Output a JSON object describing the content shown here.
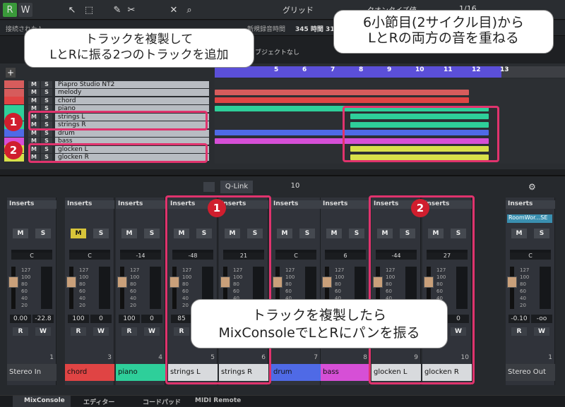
{
  "toolbar": {
    "grid_label": "グリッド",
    "quantize_label": "クオンタイズ値",
    "quantize_value": "1/16"
  },
  "infobar": {
    "left": "接続されたト",
    "mid": "新規録音時間",
    "free": "345 時間 31 分"
  },
  "arranger": {
    "bars": [
      "5",
      "6",
      "7",
      "8",
      "9",
      "10",
      "11",
      "12",
      "13"
    ],
    "no_object": "オブジェクトなし",
    "tracks": [
      {
        "name": "Piapro Studio NT2",
        "color": "#d65c5c"
      },
      {
        "name": "melody",
        "color": "#d65c5c"
      },
      {
        "name": "chord",
        "color": "#e04444"
      },
      {
        "name": "piano",
        "color": "#2ecf9a"
      },
      {
        "name": "strings L",
        "color": "#2ecf9a"
      },
      {
        "name": "strings R",
        "color": "#2ecf9a"
      },
      {
        "name": "drum",
        "color": "#4f6ae6"
      },
      {
        "name": "bass",
        "color": "#d64fd6"
      },
      {
        "name": "glocken L",
        "color": "#d8e04a"
      },
      {
        "name": "glocken R",
        "color": "#d8e04a"
      }
    ]
  },
  "mixer": {
    "qlink": "Q-Link",
    "value": "10",
    "inserts": "Inserts",
    "fx": "RoomWor...SE",
    "channels": [
      {
        "name": "Stereo In",
        "num": "1",
        "pan": "C",
        "vol": "0.00",
        "peak": "-22.8",
        "color": "#3a3d42"
      },
      {
        "name": "chord",
        "num": "3",
        "pan": "C",
        "vol": "100",
        "peak": "0",
        "color": "#e04444"
      },
      {
        "name": "piano",
        "num": "4",
        "pan": "-14",
        "vol": "100",
        "peak": "0",
        "color": "#2ecf9a"
      },
      {
        "name": "strings L",
        "num": "5",
        "pan": "-48",
        "vol": "85",
        "peak": "0",
        "color": "#d8dadd"
      },
      {
        "name": "strings R",
        "num": "6",
        "pan": "21",
        "vol": "85",
        "peak": "0",
        "color": "#d8dadd"
      },
      {
        "name": "drum",
        "num": "7",
        "pan": "C",
        "vol": "100",
        "peak": "0",
        "color": "#4f6ae6"
      },
      {
        "name": "bass",
        "num": "8",
        "pan": "6",
        "vol": "100",
        "peak": "0",
        "color": "#d64fd6"
      },
      {
        "name": "glocken L",
        "num": "9",
        "pan": "-44",
        "vol": "100",
        "peak": "0",
        "color": "#d8dadd"
      },
      {
        "name": "glocken R",
        "num": "10",
        "pan": "27",
        "vol": "100",
        "peak": "0",
        "color": "#d8dadd"
      },
      {
        "name": "Stereo Out",
        "num": "1",
        "pan": "C",
        "vol": "-0.10",
        "peak": "-oo",
        "color": "#3a3d42"
      }
    ]
  },
  "tabs": {
    "mixconsole": "MixConsole",
    "editor": "エディター",
    "chordpad": "コードパッド",
    "midiremote": "MIDI Remote"
  },
  "callouts": {
    "dup_line1": "トラックを複製して",
    "dup_line2": "LとRに振る2つのトラックを追加",
    "layer_line1": "6小節目(2サイクル目)から",
    "layer_line2": "LとRの両方の音を重ねる",
    "pan_line1": "トラックを複製したら",
    "pan_line2": "MixConsoleでLとRにパンを振る"
  },
  "badges": {
    "one": "1",
    "two": "2"
  }
}
